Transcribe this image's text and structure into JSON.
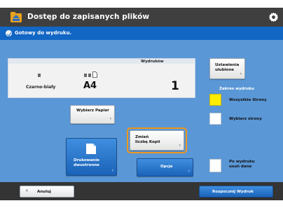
{
  "titlebar": {
    "title": "Dostęp do zapisanych plików"
  },
  "status": {
    "text": "Gotowy do wydruku."
  },
  "settings": {
    "prints_header": "Wydruków"
  },
  "mode": {
    "label": "Czarno-biały"
  },
  "paper": {
    "size": "A4",
    "select_label": "Wybierz Papier"
  },
  "copies": {
    "value": "1",
    "change_label_line1": "Zmień",
    "change_label_line2": "liczbę Kopii"
  },
  "buttons": {
    "finishing_line1": "Drukowanie",
    "finishing_line2": "dwustronne",
    "options_label": "Opcje",
    "cancel_label": "Anuluj",
    "start_label": "Rozpocznij Wydruk",
    "favorites_line1": "Ustawienia",
    "favorites_line2": "ulubione"
  },
  "side": {
    "range_header": "Zakres wydruku",
    "all_pages_label": "Wszystkie Strony",
    "select_pages_label": "Wybierz strony",
    "delete_line1": "Po wydruku",
    "delete_line2": "usuń dane"
  },
  "colors": {
    "titlebar": "#3f3f3f",
    "statusbar": "#1266c4",
    "main_bg": "#5a97d6",
    "highlight": "#f0951a",
    "yellow": "#ffed00"
  }
}
